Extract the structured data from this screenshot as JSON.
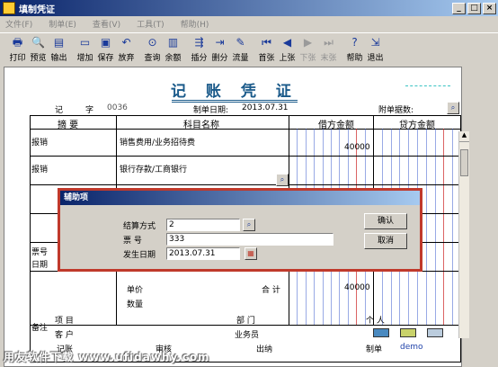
{
  "window": {
    "title": "填制凭证"
  },
  "menu": [
    "文件(F)",
    "制单(E)",
    "查看(V)",
    "工具(T)",
    "帮助(H)"
  ],
  "toolbar": [
    {
      "label": "打印",
      "icon": "printer-icon",
      "glyph": "🖶"
    },
    {
      "label": "预览",
      "icon": "preview-icon",
      "glyph": "🔍"
    },
    {
      "label": "输出",
      "icon": "export-icon",
      "glyph": "▤"
    },
    {
      "label": "增加",
      "icon": "add-icon",
      "glyph": "▭"
    },
    {
      "label": "保存",
      "icon": "save-icon",
      "glyph": "▣"
    },
    {
      "label": "放弃",
      "icon": "undo-icon",
      "glyph": "↶"
    },
    {
      "label": "查询",
      "icon": "binoculars-icon",
      "glyph": "⊙"
    },
    {
      "label": "余额",
      "icon": "balance-icon",
      "glyph": "▥"
    },
    {
      "label": "插分",
      "icon": "insert-row-icon",
      "glyph": "⇶"
    },
    {
      "label": "删分",
      "icon": "delete-row-icon",
      "glyph": "⇥"
    },
    {
      "label": "流量",
      "icon": "flow-icon",
      "glyph": "✎"
    },
    {
      "label": "首张",
      "icon": "first-icon",
      "glyph": "⏮"
    },
    {
      "label": "上张",
      "icon": "prev-icon",
      "glyph": "◀"
    },
    {
      "label": "下张",
      "icon": "next-icon",
      "glyph": "▶",
      "disabled": true
    },
    {
      "label": "末张",
      "icon": "last-icon",
      "glyph": "⏭",
      "disabled": true
    },
    {
      "label": "帮助",
      "icon": "help-icon",
      "glyph": "?"
    },
    {
      "label": "退出",
      "icon": "exit-icon",
      "glyph": "⇲"
    }
  ],
  "voucher": {
    "title": "记 账 凭 证",
    "type_label": "记",
    "number_label": "字",
    "number": "0036",
    "date_label": "制单日期:",
    "date": "2013.07.31",
    "attach_label": "附单据数:",
    "col_summary": "摘 要",
    "col_account": "科目名称",
    "col_debit": "借方金额",
    "col_credit": "贷方金额",
    "rows": [
      {
        "summary": "报销",
        "account": "销售费用/业务招待费",
        "debit": "40000"
      },
      {
        "summary": "报销",
        "account": "银行存款/工商银行",
        "debit": ""
      }
    ],
    "total_debit": "40000",
    "total_label": "合 计",
    "ticket_label": "票号",
    "date2_label": "日期",
    "price_label": "单价",
    "qty_label": "数量",
    "remark_label": "备注",
    "project_label": "项 目",
    "customer_label": "客 户",
    "dept_label": "部 门",
    "salesman_label": "业务员",
    "person_label": "个 人",
    "footer": [
      "记账",
      "审核",
      "出纳",
      "制单"
    ],
    "maker": "demo"
  },
  "dialog": {
    "title": "辅助项",
    "settlement_label": "结算方式",
    "settlement_value": "2",
    "ticket_label": "票 号",
    "ticket_value": "333",
    "date_label": "发生日期",
    "date_value": "2013.07.31",
    "ok": "确认",
    "cancel": "取消"
  },
  "watermark": "用友软件下载 www.ufidawhy.com"
}
